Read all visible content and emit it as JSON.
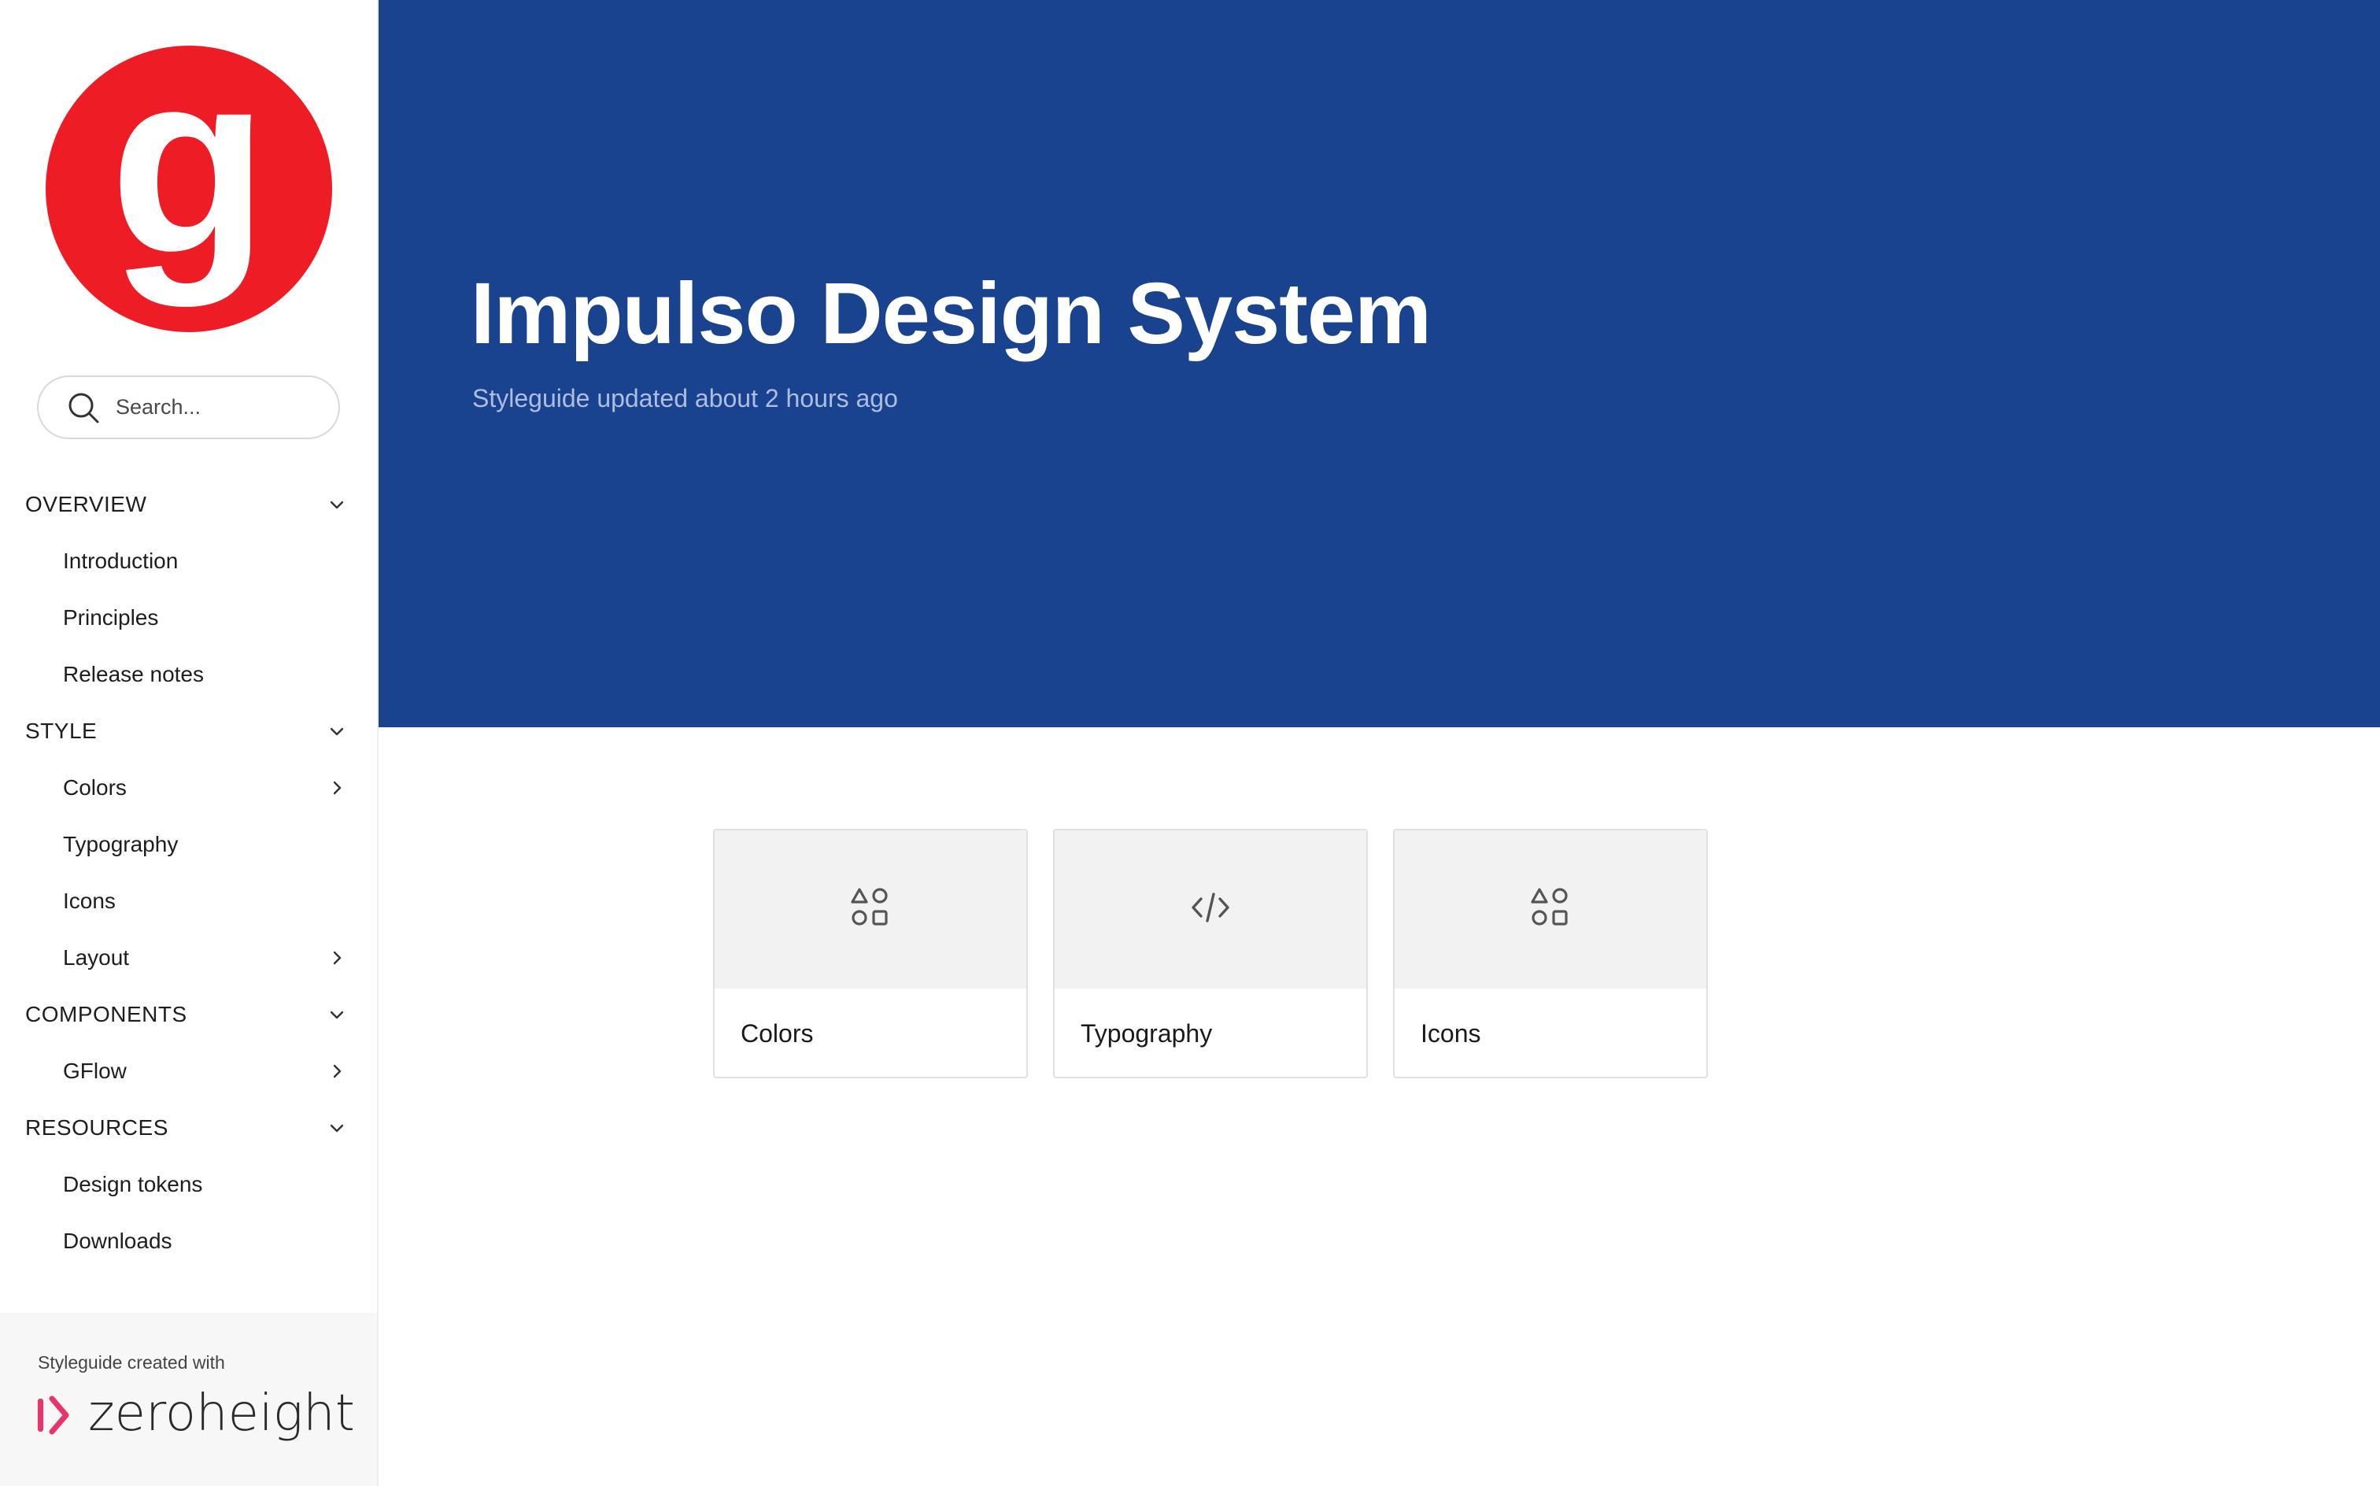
{
  "sidebar": {
    "logo_letter": "g",
    "search": {
      "placeholder": "Search..."
    },
    "nav": [
      {
        "type": "section",
        "label": "OVERVIEW",
        "chevron": "down"
      },
      {
        "type": "item",
        "label": "Introduction"
      },
      {
        "type": "item",
        "label": "Principles"
      },
      {
        "type": "item",
        "label": "Release notes"
      },
      {
        "type": "section",
        "label": "STYLE",
        "chevron": "down"
      },
      {
        "type": "item",
        "label": "Colors",
        "chevron": "right"
      },
      {
        "type": "item",
        "label": "Typography"
      },
      {
        "type": "item",
        "label": "Icons"
      },
      {
        "type": "item",
        "label": "Layout",
        "chevron": "right"
      },
      {
        "type": "section",
        "label": "COMPONENTS",
        "chevron": "down"
      },
      {
        "type": "item",
        "label": "GFlow",
        "chevron": "right"
      },
      {
        "type": "section",
        "label": "RESOURCES",
        "chevron": "down"
      },
      {
        "type": "item",
        "label": "Design tokens"
      },
      {
        "type": "item",
        "label": "Downloads"
      }
    ],
    "footer": {
      "caption": "Styleguide created with",
      "brand": "zeroheight"
    }
  },
  "hero": {
    "title": "Impulso Design System",
    "subtitle": "Styleguide updated about 2 hours ago"
  },
  "cards": [
    {
      "label": "Colors",
      "icon": "shapes-icon"
    },
    {
      "label": "Typography",
      "icon": "code-icon"
    },
    {
      "label": "Icons",
      "icon": "shapes-icon"
    }
  ],
  "colors": {
    "hero_bg": "#19428f",
    "logo_red": "#ee1c25",
    "brand_pink": "#e8336d"
  }
}
